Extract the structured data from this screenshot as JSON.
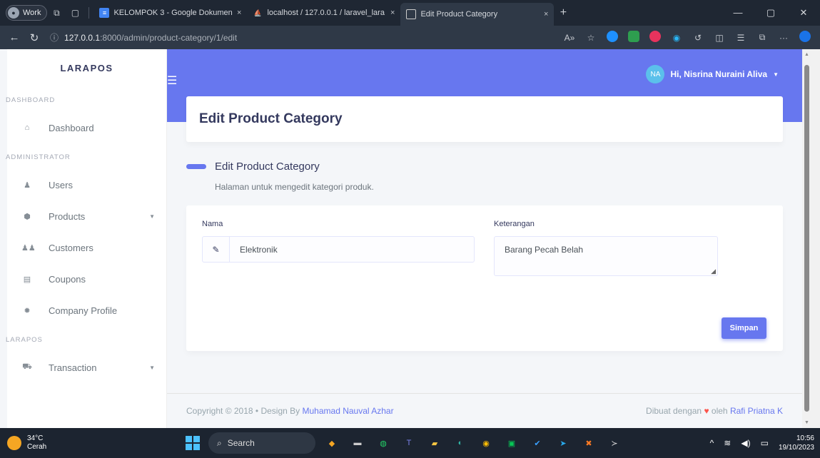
{
  "browser": {
    "profile": "Work",
    "tabs": [
      {
        "title": "KELOMPOK 3 - Google Dokumen",
        "close": "×"
      },
      {
        "title": "localhost / 127.0.0.1 / laravel_lara",
        "close": "×"
      },
      {
        "title": "Edit Product Category",
        "close": "×"
      }
    ],
    "new_tab": "+",
    "url_host": "127.0.0.1",
    "url_rest": ":8000/admin/product-category/1/edit"
  },
  "sidebar": {
    "brand": "LARAPOS",
    "headers": [
      "DASHBOARD",
      "ADMINISTRATOR",
      "LARAPOS"
    ],
    "items": [
      {
        "label": "Dashboard",
        "icon": "home-icon"
      },
      {
        "label": "Users",
        "icon": "user-icon"
      },
      {
        "label": "Products",
        "icon": "box-icon"
      },
      {
        "label": "Customers",
        "icon": "users-icon"
      },
      {
        "label": "Coupons",
        "icon": "ticket-icon"
      },
      {
        "label": "Company Profile",
        "icon": "gear-icon"
      },
      {
        "label": "Transaction",
        "icon": "cart-icon"
      }
    ]
  },
  "topnav": {
    "user_initials": "NA",
    "user_greeting": "Hi, Nisrina Nuraini Aliva"
  },
  "page": {
    "header_title": "Edit Product Category",
    "section_title": "Edit Product Category",
    "section_lead": "Halaman untuk mengedit kategori produk.",
    "form": {
      "nama_label": "Nama",
      "nama_value": "Elektronik",
      "keterangan_label": "Keterangan",
      "keterangan_value": "Barang Pecah Belah",
      "submit_label": "Simpan"
    }
  },
  "footer": {
    "copyright": "Copyright © 2018",
    "design_by": "Design By",
    "designer": "Muhamad Nauval Azhar",
    "made_with": "Dibuat dengan",
    "by": "oleh",
    "author": "Rafi Priatna K"
  },
  "taskbar": {
    "temp": "34°C",
    "weather": "Cerah",
    "search": "Search",
    "time": "10:56",
    "date": "19/10/2023"
  },
  "colors": {
    "primary": "#6777ef",
    "heart": "#fc544b"
  }
}
